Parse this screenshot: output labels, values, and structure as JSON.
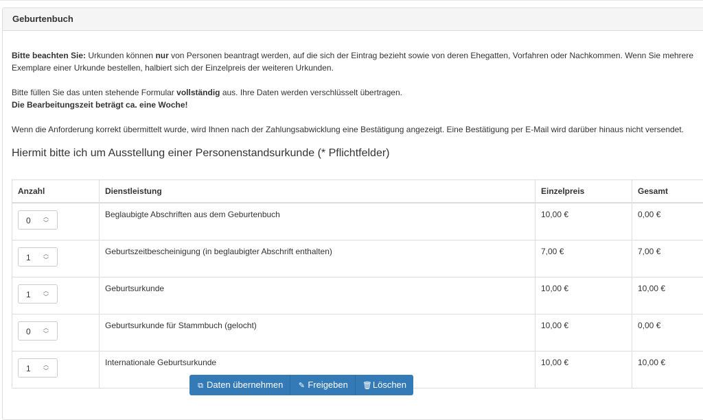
{
  "panel": {
    "title": "Geburtenbuch"
  },
  "notice": {
    "p1_bold": "Bitte beachten Sie:",
    "p1_a": " Urkunden können ",
    "p1_bold2": "nur",
    "p1_b": " von Personen beantragt werden, auf die sich der Eintrag bezieht sowie von deren Ehegatten, Vorfahren oder Nachkommen. Wenn Sie mehrere Exemplare einer Urkunde bestellen, halbiert sich der Einzelpreis der weiteren Urkunden.",
    "p2_a": "Bitte füllen Sie das unten stehende Formular ",
    "p2_bold": "vollständig",
    "p2_b": " aus. Ihre Daten werden verschlüsselt übertragen.",
    "p2_line2": "Die Bearbeitungszeit beträgt ca. eine Woche!",
    "p3": "Wenn die Anforderung korrekt übermittelt wurde, wird Ihnen nach der Zahlungsabwicklung eine Bestätigung angezeigt. Eine Bestätigung per E-Mail wird darüber hinaus nicht versendet."
  },
  "form_title": "Hiermit bitte ich um Ausstellung einer Personenstandsurkunde (* Pflichtfelder)",
  "table": {
    "headers": {
      "qty": "Anzahl",
      "service": "Dienstleistung",
      "unit_price": "Einzelpreis",
      "total": "Gesamt"
    },
    "rows": [
      {
        "qty": "0",
        "service": "Beglaubigte Abschriften aus dem Geburtenbuch",
        "unit_price": "10,00 €",
        "total": "0,00 €"
      },
      {
        "qty": "1",
        "service": "Geburtszeitbescheinigung (in beglaubigter Abschrift enthalten)",
        "unit_price": "7,00 €",
        "total": "7,00 €"
      },
      {
        "qty": "1",
        "service": "Geburtsurkunde",
        "unit_price": "10,00 €",
        "total": "10,00 €"
      },
      {
        "qty": "0",
        "service": "Geburtsurkunde für Stammbuch (gelocht)",
        "unit_price": "10,00 €",
        "total": "0,00 €"
      },
      {
        "qty": "1",
        "service": "Internationale Geburtsurkunde",
        "unit_price": "10,00 €",
        "total": "10,00 €"
      }
    ]
  },
  "buttons": {
    "apply": {
      "label": "Daten übernehmen",
      "icon": "copy-icon"
    },
    "release": {
      "label": "Freigeben",
      "icon": "edit-icon"
    },
    "delete": {
      "label": "Löschen",
      "icon": "trash-icon"
    }
  },
  "colors": {
    "primary": "#337ab7",
    "border": "#dddddd",
    "heading_bg": "#f5f5f5"
  }
}
